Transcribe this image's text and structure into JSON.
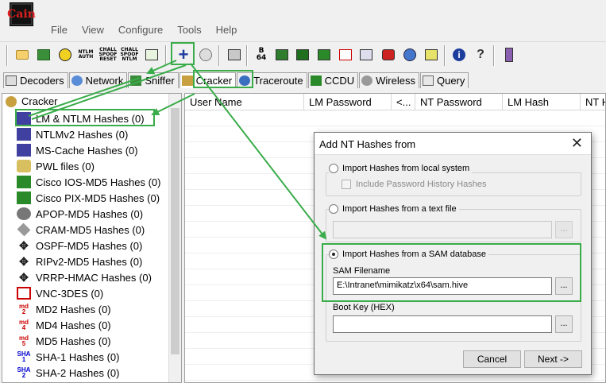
{
  "app": {
    "logo_text": "Cain"
  },
  "menu": [
    "File",
    "View",
    "Configure",
    "Tools",
    "Help"
  ],
  "toolbar": {
    "ntlm_auth_text": "NTLM\nAUTH",
    "chall_spoof_reset_text": "CHALL\nSPOOF\nRESET",
    "chall_spoof_ntlm_text": "CHALL\nSPOOF\nNTLM",
    "add_button_glyph": "+",
    "base64_text": "B\n64",
    "help_glyph": "i",
    "question_glyph": "?"
  },
  "tabs": [
    "Decoders",
    "Network",
    "Sniffer",
    "Cracker",
    "Traceroute",
    "CCDU",
    "Wireless",
    "Query"
  ],
  "tree": {
    "root": "Cracker",
    "items": [
      {
        "label": "LM & NTLM Hashes (0)",
        "icon": "LM"
      },
      {
        "label": "NTLMv2 Hashes (0)",
        "icon": ""
      },
      {
        "label": "MS-Cache Hashes (0)",
        "icon": ""
      },
      {
        "label": "PWL files (0)",
        "icon": ""
      },
      {
        "label": "Cisco IOS-MD5 Hashes (0)",
        "icon": ""
      },
      {
        "label": "Cisco PIX-MD5 Hashes (0)",
        "icon": ""
      },
      {
        "label": "APOP-MD5 Hashes (0)",
        "icon": ""
      },
      {
        "label": "CRAM-MD5 Hashes (0)",
        "icon": ""
      },
      {
        "label": "OSPF-MD5 Hashes (0)",
        "icon": ""
      },
      {
        "label": "RIPv2-MD5 Hashes (0)",
        "icon": ""
      },
      {
        "label": "VRRP-HMAC Hashes (0)",
        "icon": ""
      },
      {
        "label": "VNC-3DES (0)",
        "icon": ""
      },
      {
        "label": "MD2 Hashes (0)",
        "icon": "md\n2"
      },
      {
        "label": "MD4 Hashes (0)",
        "icon": "md\n4"
      },
      {
        "label": "MD5 Hashes (0)",
        "icon": "md\n5"
      },
      {
        "label": "SHA-1 Hashes (0)",
        "icon": "SHA\n1"
      },
      {
        "label": "SHA-2 Hashes (0)",
        "icon": "SHA\n2"
      }
    ]
  },
  "list": {
    "columns": [
      "User Name",
      "LM Password",
      "<...",
      "NT Password",
      "LM Hash",
      "NT H"
    ]
  },
  "dialog": {
    "title": "Add NT Hashes from",
    "close_glyph": "✕",
    "opt_local": "Import Hashes from local system",
    "include_history": "Include Password History Hashes",
    "opt_text": "Import Hashes from a text file",
    "text_file_value": "",
    "opt_sam": "Import Hashes from a SAM database",
    "sam_label": "SAM Filename",
    "sam_value": "E:\\Intranet\\mimikatz\\x64\\sam.hive",
    "boot_label": "Boot Key (HEX)",
    "boot_value": "",
    "browse_label": "...",
    "cancel": "Cancel",
    "next": "Next ->",
    "selected_option": "sam"
  },
  "colors": {
    "annotation": "#3aac4a",
    "plus": "#1c3c9e",
    "logo_text": "#e02020"
  }
}
